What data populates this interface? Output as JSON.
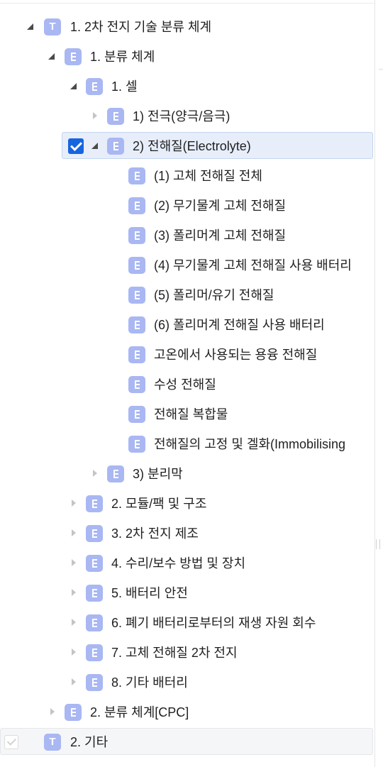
{
  "tree": {
    "rows": [
      {
        "label": "1. 2차 전지 기술 분류 체계",
        "icon": "root-t-icon",
        "icon_text": "T",
        "toggle": "expanded"
      },
      {
        "label": "1. 분류 체계",
        "icon": "node-icon",
        "toggle": "expanded"
      },
      {
        "label": "1. 셀",
        "icon": "node-icon",
        "toggle": "expanded"
      },
      {
        "label": "1) 전극(양극/음극)",
        "icon": "node-icon",
        "toggle": "collapsed"
      },
      {
        "label": "2) 전해질(Electrolyte)",
        "icon": "node-icon",
        "toggle": "expanded",
        "checked": true,
        "selected": true
      },
      {
        "label": "(1) 고체 전해질 전체",
        "icon": "node-icon"
      },
      {
        "label": "(2) 무기물계 고체 전해질",
        "icon": "node-icon"
      },
      {
        "label": "(3) 폴리머계 고체 전해질",
        "icon": "node-icon"
      },
      {
        "label": "(4) 무기물계 고체 전해질 사용 배터리",
        "icon": "node-icon"
      },
      {
        "label": "(5) 폴리머/유기 전해질",
        "icon": "node-icon"
      },
      {
        "label": "(6) 폴리머계 전해질 사용 배터리",
        "icon": "node-icon"
      },
      {
        "label": "고온에서 사용되는 용융 전해질",
        "icon": "node-icon"
      },
      {
        "label": "수성 전해질",
        "icon": "node-icon"
      },
      {
        "label": "전해질 복합물",
        "icon": "node-icon"
      },
      {
        "label": "전해질의 고정 및 겔화(Immobilising",
        "icon": "node-icon"
      },
      {
        "label": "3) 분리막",
        "icon": "node-icon",
        "toggle": "collapsed"
      },
      {
        "label": "2. 모듈/팩 및 구조",
        "icon": "node-icon",
        "toggle": "collapsed"
      },
      {
        "label": "3. 2차 전지 제조",
        "icon": "node-icon",
        "toggle": "collapsed"
      },
      {
        "label": "4. 수리/보수 방법 및 장치",
        "icon": "node-icon",
        "toggle": "collapsed"
      },
      {
        "label": "5. 배터리 안전",
        "icon": "node-icon",
        "toggle": "collapsed"
      },
      {
        "label": "6. 폐기 배터리로부터의 재생 자원 회수",
        "icon": "node-icon",
        "toggle": "collapsed"
      },
      {
        "label": "7. 고체 전해질 2차 전지",
        "icon": "node-icon",
        "toggle": "collapsed"
      },
      {
        "label": "8. 기타 배터리",
        "icon": "node-icon",
        "toggle": "collapsed"
      },
      {
        "label": "2. 분류 체계[CPC]",
        "icon": "node-icon",
        "toggle": "collapsed"
      },
      {
        "label": "2. 기타",
        "icon": "root-t-icon",
        "icon_text": "T",
        "checked": true
      }
    ]
  },
  "colors": {
    "icon_bg": "#a9b7f3",
    "checkbox": "#1565e0",
    "selection_bg": "#e7eefa",
    "selection_border": "#c3d5ef"
  }
}
